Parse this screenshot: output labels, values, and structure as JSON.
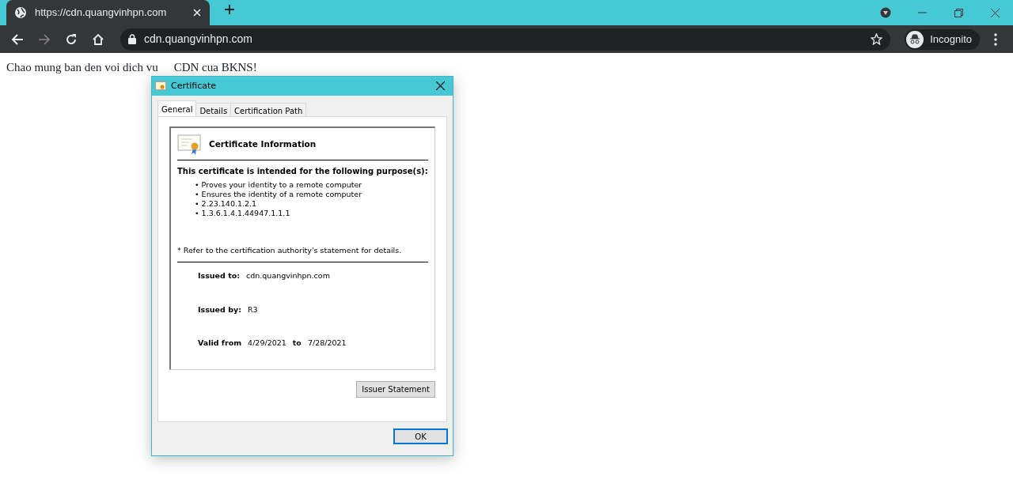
{
  "browser": {
    "tabs": [
      {
        "title": "https://cdn.quangvinhpn.com",
        "selected": true
      }
    ],
    "address": "cdn.quangvinhpn.com",
    "profile": "Incognito"
  },
  "page": {
    "texts": [
      "Chao mung ban den voi dich vu",
      "CDN cua BKNS!"
    ]
  },
  "dialog": {
    "title": "Certificate",
    "tabs": [
      {
        "label": "General",
        "selected": true
      },
      {
        "label": "Details",
        "selected": false
      },
      {
        "label": "Certification Path",
        "selected": false
      }
    ],
    "heading": "Certificate Information",
    "purpose_title": "This certificate is intended for the following purpose(s):",
    "purposes": [
      "• Proves your identity to a remote computer",
      "• Ensures the identity of a remote computer",
      "• 2.23.140.1.2.1",
      "• 1.3.6.1.4.1.44947.1.1.1"
    ],
    "note": "* Refer to the certification authority's statement for details.",
    "issued_to": {
      "label": "Issued to:",
      "value": "cdn.quangvinhpn.com"
    },
    "issued_by": {
      "label": "Issued by:",
      "value": "R3"
    },
    "valid": {
      "label": "Valid from",
      "from": "4/29/2021",
      "to_label": "to",
      "to": "7/28/2021"
    },
    "issuer_button": "Issuer Statement",
    "ok_button": "OK"
  }
}
